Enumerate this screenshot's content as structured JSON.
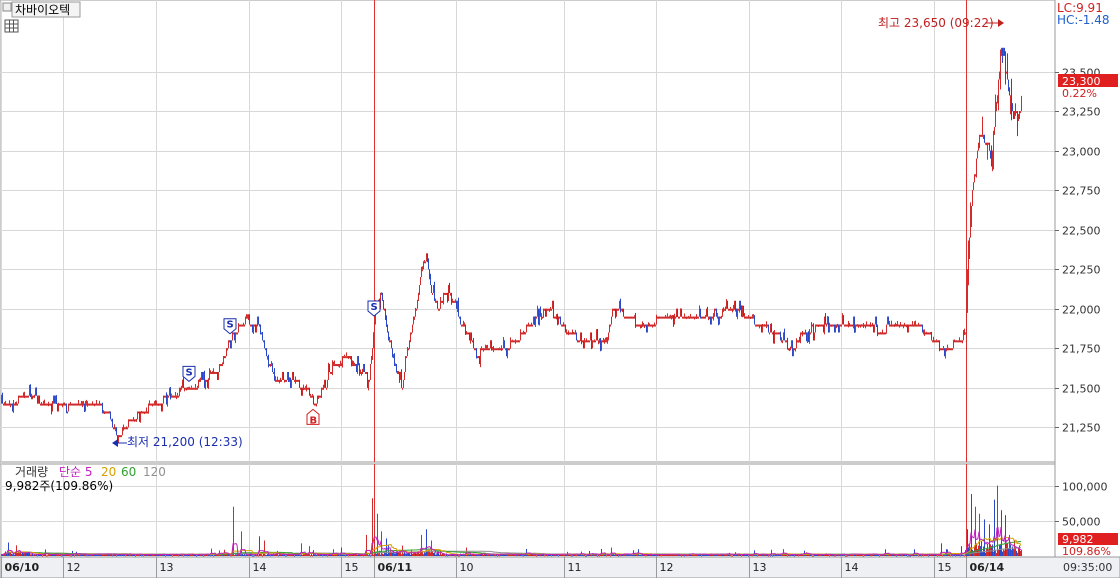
{
  "header": {
    "stock_name": "차바이오텍",
    "lc_text": "LC:9.91",
    "hc_text": "HC:-1.48",
    "menu_icon": "grid-menu-icon"
  },
  "price_panel": {
    "high_annotation": "최고 23,650 (09:22)",
    "low_annotation": "최저 21,200 (12:33)",
    "current_price": "23,300",
    "change_pct": "0.22%",
    "y_ticks": [
      "23,500",
      "23,250",
      "23,000",
      "22,750",
      "22,500",
      "22,250",
      "22,000",
      "21,750",
      "21,500",
      "21,250"
    ],
    "y_tick_values": [
      23500,
      23250,
      23000,
      22750,
      22500,
      22250,
      22000,
      21750,
      21500,
      21250
    ],
    "ylim": [
      21100,
      23700
    ],
    "signals": [
      {
        "type": "S",
        "bar": 229
      },
      {
        "type": "S",
        "bar": 188
      },
      {
        "type": "S",
        "bar": 373
      },
      {
        "type": "B",
        "bar": 312
      }
    ]
  },
  "volume_panel": {
    "legend_prefix": "거래량",
    "legend_ma5": "단순 5",
    "legend_20": "20",
    "legend_60": "60",
    "legend_120": "120",
    "volume_info": "9,982주(109.86%)",
    "current_volume": "9,982",
    "current_volume_pct": "109.86%",
    "y_ticks": [
      "100,000",
      "50,000"
    ],
    "y_tick_values": [
      100000,
      50000
    ],
    "ylim": [
      0,
      125000
    ]
  },
  "x_axis": {
    "labels": [
      "06/10",
      "12",
      "13",
      "14",
      "15",
      "06/11",
      "10",
      "11",
      "12",
      "13",
      "14",
      "15",
      "06/14"
    ],
    "label_bars": [
      0,
      62,
      155,
      248,
      340,
      373,
      455,
      563,
      655,
      748,
      840,
      933,
      965
    ],
    "bold_labels": [
      "06/10",
      "06/11",
      "06/14"
    ],
    "session_separators": [
      373,
      965
    ],
    "time_label": "09:35:00"
  },
  "colors": {
    "up": "#d22b2b",
    "down": "#2b48c8",
    "grid": "#d8d8d8",
    "separator": "#e03030",
    "ma5": "#c020c0",
    "ma20": "#d4a000",
    "ma60": "#30a030",
    "ma120": "#909090",
    "price_box": "#e02020",
    "axis_text": "#333333",
    "lc": "#d02020",
    "hc": "#2060d0"
  },
  "chart_data": {
    "type": "candlestick-with-volume",
    "price_keyframes": [
      [
        0,
        21400
      ],
      [
        15,
        21420
      ],
      [
        30,
        21470
      ],
      [
        40,
        21380
      ],
      [
        50,
        21420
      ],
      [
        80,
        21420
      ],
      [
        100,
        21380
      ],
      [
        108,
        21330
      ],
      [
        115,
        21210
      ],
      [
        120,
        21220
      ],
      [
        130,
        21300
      ],
      [
        145,
        21370
      ],
      [
        160,
        21420
      ],
      [
        175,
        21470
      ],
      [
        190,
        21500
      ],
      [
        205,
        21560
      ],
      [
        220,
        21640
      ],
      [
        232,
        21850
      ],
      [
        245,
        21930
      ],
      [
        258,
        21880
      ],
      [
        266,
        21680
      ],
      [
        275,
        21560
      ],
      [
        290,
        21540
      ],
      [
        305,
        21510
      ],
      [
        313,
        21400
      ],
      [
        320,
        21480
      ],
      [
        330,
        21620
      ],
      [
        345,
        21700
      ],
      [
        355,
        21640
      ],
      [
        368,
        21560
      ],
      [
        374,
        21980
      ],
      [
        380,
        22120
      ],
      [
        385,
        21880
      ],
      [
        395,
        21620
      ],
      [
        401,
        21500
      ],
      [
        408,
        21820
      ],
      [
        415,
        22010
      ],
      [
        420,
        22250
      ],
      [
        425,
        22340
      ],
      [
        430,
        22120
      ],
      [
        437,
        22000
      ],
      [
        445,
        22120
      ],
      [
        455,
        22000
      ],
      [
        462,
        21900
      ],
      [
        475,
        21720
      ],
      [
        490,
        21740
      ],
      [
        505,
        21760
      ],
      [
        515,
        21800
      ],
      [
        525,
        21880
      ],
      [
        535,
        21930
      ],
      [
        545,
        22000
      ],
      [
        555,
        21960
      ],
      [
        565,
        21870
      ],
      [
        575,
        21820
      ],
      [
        590,
        21780
      ],
      [
        605,
        21790
      ],
      [
        612,
        22010
      ],
      [
        625,
        21960
      ],
      [
        635,
        21920
      ],
      [
        650,
        21900
      ],
      [
        660,
        21960
      ],
      [
        700,
        21970
      ],
      [
        740,
        21980
      ],
      [
        760,
        21900
      ],
      [
        780,
        21820
      ],
      [
        790,
        21730
      ],
      [
        800,
        21840
      ],
      [
        815,
        21880
      ],
      [
        840,
        21880
      ],
      [
        860,
        21890
      ],
      [
        880,
        21870
      ],
      [
        900,
        21900
      ],
      [
        920,
        21880
      ],
      [
        940,
        21760
      ],
      [
        955,
        21780
      ],
      [
        964,
        21840
      ],
      [
        966,
        22300
      ],
      [
        972,
        22820
      ],
      [
        978,
        23100
      ],
      [
        985,
        23060
      ],
      [
        990,
        22930
      ],
      [
        995,
        23320
      ],
      [
        1000,
        23650
      ],
      [
        1006,
        23450
      ],
      [
        1012,
        23220
      ],
      [
        1020,
        23280
      ]
    ],
    "volume_spikes": [
      [
        232,
        70000
      ],
      [
        240,
        35000
      ],
      [
        258,
        28000
      ],
      [
        263,
        22000
      ],
      [
        300,
        18000
      ],
      [
        308,
        14000
      ],
      [
        340,
        12000
      ],
      [
        365,
        30000
      ],
      [
        371,
        82000
      ],
      [
        373,
        42000
      ],
      [
        376,
        60000
      ],
      [
        380,
        35000
      ],
      [
        385,
        25000
      ],
      [
        420,
        30000
      ],
      [
        425,
        38000
      ],
      [
        430,
        22000
      ],
      [
        465,
        12000
      ],
      [
        525,
        10000
      ],
      [
        600,
        10000
      ],
      [
        610,
        12000
      ],
      [
        940,
        18000
      ],
      [
        960,
        14000
      ],
      [
        966,
        38000
      ],
      [
        970,
        88000
      ],
      [
        974,
        70000
      ],
      [
        978,
        60000
      ],
      [
        983,
        52000
      ],
      [
        988,
        45000
      ],
      [
        993,
        80000
      ],
      [
        996,
        100000
      ],
      [
        1000,
        65000
      ],
      [
        1004,
        58000
      ],
      [
        1008,
        30000
      ],
      [
        1013,
        22000
      ],
      [
        1018,
        15000
      ]
    ]
  }
}
